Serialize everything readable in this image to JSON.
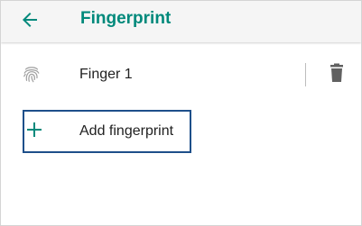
{
  "appbar": {
    "title": "Fingerprint",
    "back_icon": "arrow-left-icon"
  },
  "fingers": [
    {
      "label": "Finger 1",
      "icon": "fingerprint-icon",
      "action_icon": "trash-icon"
    }
  ],
  "add": {
    "label": "Add fingerprint",
    "icon": "plus-icon"
  },
  "colors": {
    "accent": "#00897b",
    "focus_border": "#1e4f8a",
    "appbar_bg": "#f5f5f5",
    "text": "#212121",
    "icon_gray": "#616161"
  }
}
